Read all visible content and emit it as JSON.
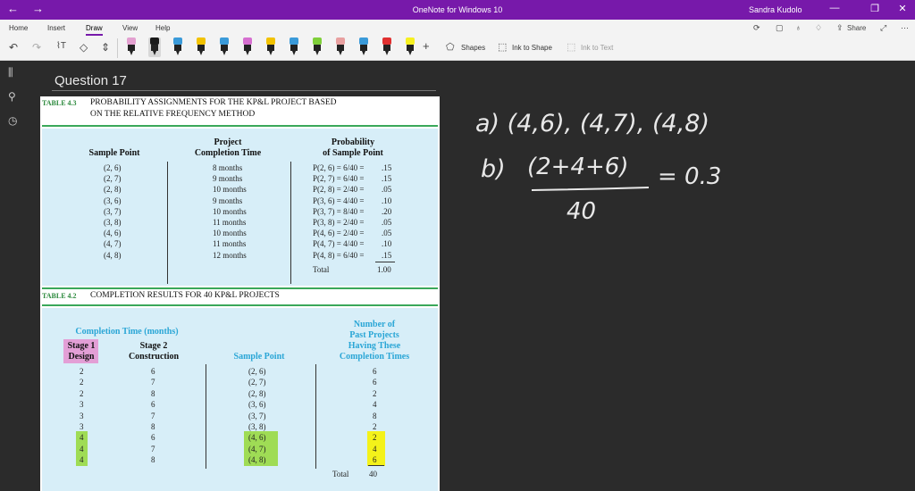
{
  "window": {
    "title": "OneNote for Windows 10",
    "user": "Sandra Kudolo"
  },
  "menu": {
    "tabs": [
      "Home",
      "Insert",
      "Draw",
      "View",
      "Help"
    ],
    "active": "Draw",
    "share_label": "Share"
  },
  "toolbar": {
    "shapes_label": "Shapes",
    "ink_to_shape_label": "Ink to Shape",
    "ink_to_text_label": "Ink to Text",
    "pen_colors": [
      "#e3a0d0",
      "#1a1a1a",
      "#3a9ad9",
      "#f2c200",
      "#3a9ad9",
      "#d66fd0",
      "#f2c200",
      "#3a9ad9",
      "#7fcf3a",
      "#e8a0a0",
      "#3a9ad9",
      "#e03030",
      "#f6f020"
    ]
  },
  "page": {
    "title": "Question 17"
  },
  "table43": {
    "label": "TABLE 4.3",
    "caption_line1": "PROBABILITY ASSIGNMENTS FOR THE KP&L PROJECT BASED",
    "caption_line2": "ON THE RELATIVE FREQUENCY METHOD",
    "headers": {
      "col1": "Sample Point",
      "col2_line1": "Project",
      "col2_line2": "Completion Time",
      "col3_line1": "Probability",
      "col3_line2": "of Sample Point"
    },
    "rows": [
      {
        "point": "(2, 6)",
        "time": "8 months",
        "prob": "P(2, 6) = 6/40 =",
        "val": ".15"
      },
      {
        "point": "(2, 7)",
        "time": "9 months",
        "prob": "P(2, 7) = 6/40 =",
        "val": ".15"
      },
      {
        "point": "(2, 8)",
        "time": "10 months",
        "prob": "P(2, 8) = 2/40 =",
        "val": ".05"
      },
      {
        "point": "(3, 6)",
        "time": "9 months",
        "prob": "P(3, 6) = 4/40 =",
        "val": ".10"
      },
      {
        "point": "(3, 7)",
        "time": "10 months",
        "prob": "P(3, 7) = 8/40 =",
        "val": ".20"
      },
      {
        "point": "(3, 8)",
        "time": "11 months",
        "prob": "P(3, 8) = 2/40 =",
        "val": ".05"
      },
      {
        "point": "(4, 6)",
        "time": "10 months",
        "prob": "P(4, 6) = 2/40 =",
        "val": ".05"
      },
      {
        "point": "(4, 7)",
        "time": "11 months",
        "prob": "P(4, 7) = 4/40 =",
        "val": ".10"
      },
      {
        "point": "(4, 8)",
        "time": "12 months",
        "prob": "P(4, 8) = 6/40 =",
        "val": ".15"
      }
    ],
    "total_label": "Total",
    "total_value": "1.00"
  },
  "table42": {
    "label": "TABLE 4.2",
    "caption": "COMPLETION RESULTS FOR 40 KP&L PROJECTS",
    "headers": {
      "group": "Completion Time (months)",
      "stage1_line1": "Stage 1",
      "stage1_line2": "Design",
      "stage2_line1": "Stage 2",
      "stage2_line2": "Construction",
      "point": "Sample Point",
      "num_line1": "Number of",
      "num_line2": "Past Projects",
      "num_line3": "Having These",
      "num_line4": "Completion Times"
    },
    "rows": [
      {
        "s1": "2",
        "s2": "6",
        "point": "(2, 6)",
        "n": "6"
      },
      {
        "s1": "2",
        "s2": "7",
        "point": "(2, 7)",
        "n": "6"
      },
      {
        "s1": "2",
        "s2": "8",
        "point": "(2, 8)",
        "n": "2"
      },
      {
        "s1": "3",
        "s2": "6",
        "point": "(3, 6)",
        "n": "4"
      },
      {
        "s1": "3",
        "s2": "7",
        "point": "(3, 7)",
        "n": "8"
      },
      {
        "s1": "3",
        "s2": "8",
        "point": "(3, 8)",
        "n": "2"
      },
      {
        "s1": "4",
        "s2": "6",
        "point": "(4, 6)",
        "n": "2"
      },
      {
        "s1": "4",
        "s2": "7",
        "point": "(4, 7)",
        "n": "4"
      },
      {
        "s1": "4",
        "s2": "8",
        "point": "(4, 8)",
        "n": "6"
      }
    ],
    "total_label": "Total",
    "total_value": "40"
  },
  "ink_notes": {
    "line_a": "a) (4,6), (4,7), (4,8)",
    "line_b_label": "b)",
    "line_b_numerator": "(2+4+6)",
    "line_b_denominator": "40",
    "line_b_result": "= 0.3"
  },
  "colors": {
    "accent": "#7719aa",
    "table_bg": "#d7eef8",
    "table_green": "#3aa85a",
    "header_cyan": "#2aa6d6",
    "highlight_pink": "#e39fd6",
    "highlight_green": "#9fdc55",
    "highlight_yellow": "#f4f21a"
  }
}
